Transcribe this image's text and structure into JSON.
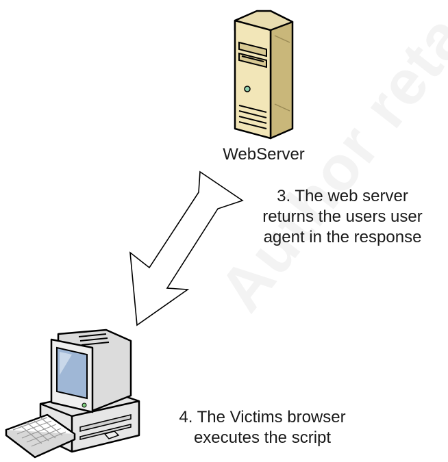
{
  "diagram": {
    "server": {
      "label": "WebServer",
      "icon": "server-tower-icon"
    },
    "client": {
      "icon": "desktop-computer-icon"
    },
    "arrow": {
      "icon": "down-left-arrow-icon"
    },
    "steps": [
      {
        "lines": [
          "3. The web server",
          "returns the users user",
          "agent in the response"
        ]
      },
      {
        "lines": [
          "4. The Victims browser",
          "executes the script"
        ]
      }
    ],
    "watermark": "Author reta"
  },
  "colors": {
    "server_body": "#f2e6b8",
    "server_shadow": "#c9b77a",
    "screen": "#9fb7d6",
    "outline": "#000000"
  }
}
